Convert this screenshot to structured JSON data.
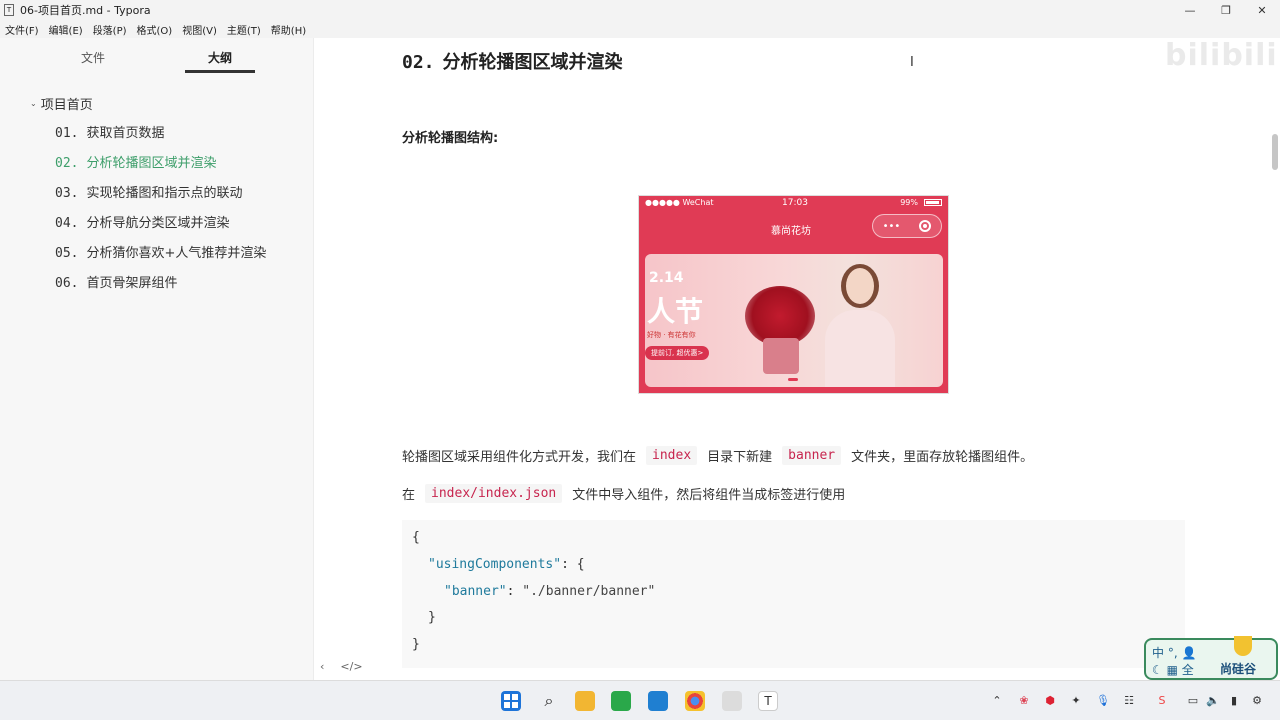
{
  "window": {
    "title": "06-项目首页.md - Typora",
    "app_icon": "T",
    "controls": [
      "—",
      "❐",
      "✕"
    ]
  },
  "menu": [
    "文件(F)",
    "编辑(E)",
    "段落(P)",
    "格式(O)",
    "视图(V)",
    "主题(T)",
    "帮助(H)"
  ],
  "sidebar": {
    "tabs": [
      "文件",
      "大纲"
    ],
    "active_tab": "大纲",
    "root": "项目首页",
    "items": [
      {
        "num": "01.",
        "label": "获取首页数据"
      },
      {
        "num": "02.",
        "label": "分析轮播图区域并渲染"
      },
      {
        "num": "03.",
        "label": "实现轮播图和指示点的联动"
      },
      {
        "num": "04.",
        "label": "分析导航分类区域并渲染"
      },
      {
        "num": "05.",
        "label": "分析猜你喜欢+人气推荐并渲染"
      },
      {
        "num": "06.",
        "label": "首页骨架屏组件"
      }
    ],
    "active_index": 1,
    "bottom": [
      "‹",
      "</>"
    ]
  },
  "editor": {
    "heading_num": "02.",
    "heading": "分析轮播图区域并渲染",
    "subheading": "分析轮播图结构:",
    "cursor": "I",
    "watermark": "bilibili",
    "phone": {
      "carrier": "●●●●● WeChat",
      "time": "17:03",
      "battery": "99%",
      "nav_title": "慕尚花坊",
      "capsule_more": "•••",
      "banner_date": "2.14",
      "banner_title": "人节",
      "banner_small": "好物 · 有花有你",
      "banner_pill": "提前订, 超优惠>"
    },
    "para1": {
      "t1": "轮播图区域采用组件化方式开发，我们在",
      "c1": "index",
      "t2": "目录下新建",
      "c2": "banner",
      "t3": "文件夹，里面存放轮播图组件。"
    },
    "para2": {
      "t1": "在",
      "c1": "index/index.json",
      "t2": "文件中导入组件，然后将组件当成标签进行使用"
    },
    "code": {
      "l1": "{",
      "l2_key": "\"usingComponents\"",
      "l2_rest": ": {",
      "l3_key": "\"banner\"",
      "l3_sep": ": ",
      "l3_val": "\"./banner/banner\"",
      "l4": "}",
      "l5": "}"
    }
  },
  "badge": {
    "line1": "中 °, 👤",
    "line2": "☾ ▦ 全",
    "brand": "尚硅谷"
  },
  "taskbar": {
    "apps": [
      "windows-start",
      "search",
      "file-explorer",
      "wechat-devtools",
      "vscode",
      "chrome",
      "misc",
      "typora"
    ],
    "typora_label": "T"
  }
}
